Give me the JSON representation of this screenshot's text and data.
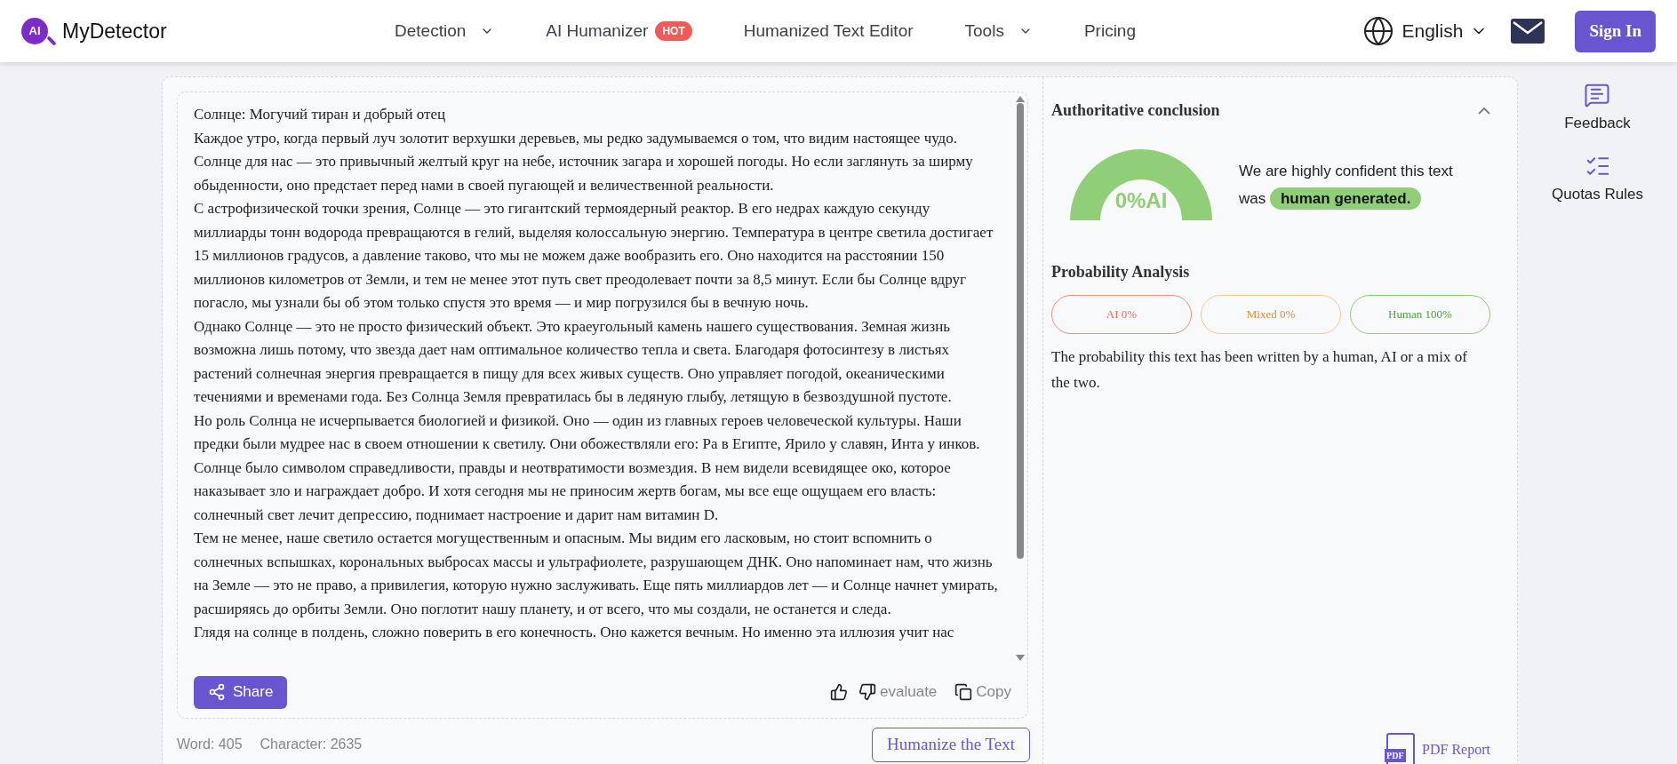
{
  "header": {
    "logo_mark": "AI",
    "logo_text": "MyDetector",
    "nav": [
      {
        "label": "Detection",
        "dropdown": true
      },
      {
        "label": "AI Humanizer",
        "dropdown": false,
        "badge": "HOT"
      },
      {
        "label": "Humanized Text Editor",
        "dropdown": false
      },
      {
        "label": "Tools",
        "dropdown": true
      },
      {
        "label": "Pricing",
        "dropdown": false
      }
    ],
    "language": "English",
    "sign_in": "Sign In"
  },
  "editor": {
    "paragraphs": [
      "Солнце: Могучий тиран и добрый отец",
      "Каждое утро, когда первый луч золотит верхушки деревьев, мы редко задумываемся о том, что видим настоящее чудо. Солнце для нас — это привычный желтый круг на небе, источник загара и хорошей погоды. Но если заглянуть за ширму обыденности, оно предстает перед нами в своей пугающей и величественной реальности.",
      "С астрофизической точки зрения, Солнце — это гигантский термоядерный реактор. В его недрах каждую секунду миллиарды тонн водорода превращаются в гелий, выделяя колоссальную энергию. Температура в центре светила достигает 15 миллионов градусов, а давление таково, что мы не можем даже вообразить его. Оно находится на расстоянии 150 миллионов километров от Земли, и тем не менее этот путь свет преодолевает почти за 8,5 минут. Если бы Солнце вдруг погасло, мы узнали бы об этом только спустя это время — и мир погрузился бы в вечную ночь.",
      "Однако Солнце — это не просто физический объект. Это краеугольный камень нашего существования. Земная жизнь возможна лишь потому, что звезда дает нам оптимальное количество тепла и света. Благодаря фотосинтезу в листьях растений солнечная энергия превращается в пищу для всех живых существ. Оно управляет погодой, океаническими течениями и временами года. Без Солнца Земля превратилась бы в ледяную глыбу, летящую в безвоздушной пустоте.",
      "Но роль Солнца не исчерпывается биологией и физикой. Оно — один из главных героев человеческой культуры. Наши предки были мудрее нас в своем отношении к светилу. Они обожествляли его: Ра в Египте, Ярило у славян, Инта у инков. Солнце было символом справедливости, правды и неотвратимости возмездия. В нем видели всевидящее око, которое наказывает зло и награждает добро. И хотя сегодня мы не приносим жертв богам, мы все еще ощущаем его власть: солнечный свет лечит депрессию, поднимает настроение и дарит нам витамин D.",
      "Тем не менее, наше светило остается могущественным и опасным. Мы видим его ласковым, но стоит вспомнить о солнечных вспышках, корональных выбросах массы и ультрафиолете, разрушающем ДНК. Оно напоминает нам, что жизнь на Земле — это не право, а привилегия, которую нужно заслуживать. Еще пять миллиардов лет — и Солнце начнет умирать, расширяясь до орбиты Земли. Оно поглотит нашу планету, и от всего, что мы создали, не останется и следа.",
      "Глядя на солнце в полдень, сложно поверить в его конечность. Оно кажется вечным. Но именно эта иллюзия учит нас"
    ],
    "share": "Share",
    "evaluate": "evaluate",
    "copy": "Copy",
    "word_count": "Word: 405",
    "char_count": "Character: 2635",
    "humanize": "Humanize the Text"
  },
  "result": {
    "title": "Authoritative conclusion",
    "expanded": true,
    "gauge_label": "0%AI",
    "verdict_text": "We are highly confident this text was",
    "verdict_tag": "human generated.",
    "analysis_title": "Probability Analysis",
    "pills": [
      {
        "label": "AI 0%",
        "color": "#f0907a"
      },
      {
        "label": "Mixed 0%",
        "color": "#f9c98f"
      },
      {
        "label": "Human 100%",
        "color": "#90cf78"
      }
    ],
    "description": "The probability this text has been written by a human, AI or a mix of the two.",
    "pdf_icon_label": "PDF",
    "pdf": "PDF Report"
  },
  "sidebar": [
    {
      "label": "Feedback",
      "kind": "feedback"
    },
    {
      "label": "Quotas Rules",
      "kind": "rules"
    }
  ]
}
